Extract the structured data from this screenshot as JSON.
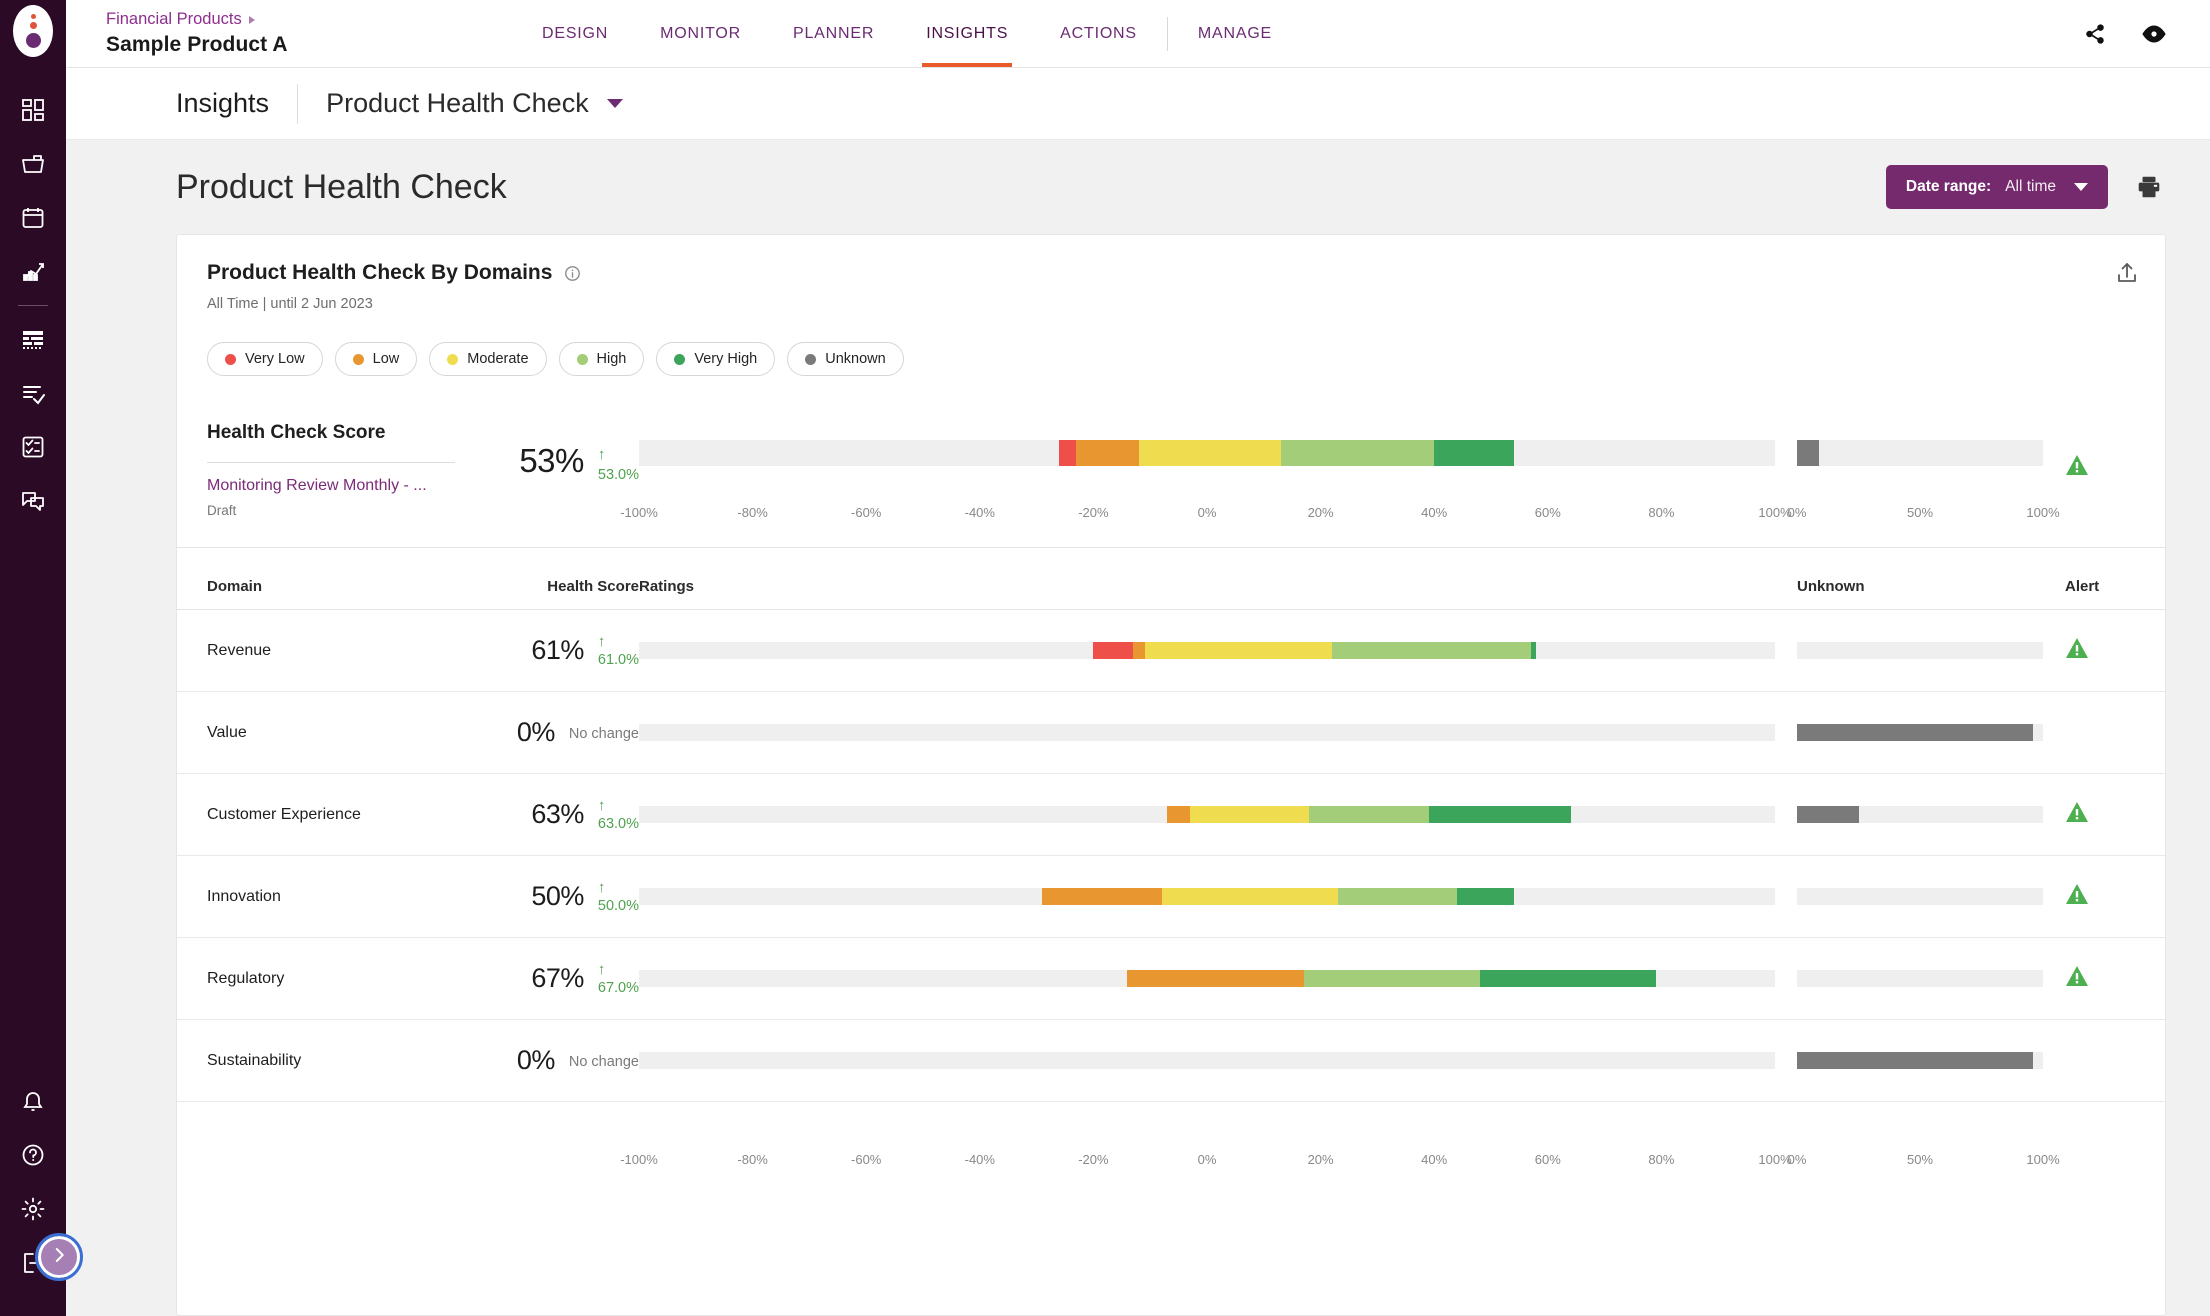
{
  "brand": {
    "accent_purple": "#6B2B72",
    "accent_orange": "#EA5B2A",
    "rail_bg": "#2B0A26"
  },
  "topbar": {
    "breadcrumb_parent": "Financial Products",
    "breadcrumb_title": "Sample Product A",
    "nav": [
      {
        "label": "DESIGN",
        "active": false
      },
      {
        "label": "MONITOR",
        "active": false
      },
      {
        "label": "PLANNER",
        "active": false
      },
      {
        "label": "INSIGHTS",
        "active": true
      },
      {
        "label": "ACTIONS",
        "active": false
      },
      {
        "label": "MANAGE",
        "active": false
      }
    ],
    "icons": [
      "share-icon",
      "eye-icon"
    ]
  },
  "insightsbar": {
    "label": "Insights",
    "selected_report": "Product Health Check"
  },
  "pagehead": {
    "title": "Product Health Check",
    "date_range_label": "Date range:",
    "date_range_value": "All time",
    "print_icon": "print-icon"
  },
  "card": {
    "title": "Product Health Check By Domains",
    "subtitle": "All Time | until 2 Jun 2023",
    "info_icon": "info-icon",
    "export_icon": "export-icon"
  },
  "legend": [
    {
      "label": "Very Low",
      "color": "#EE4F49"
    },
    {
      "label": "Low",
      "color": "#E8962F"
    },
    {
      "label": "Moderate",
      "color": "#EFDC4F"
    },
    {
      "label": "High",
      "color": "#A3CD78"
    },
    {
      "label": "Very High",
      "color": "#3BA55C"
    },
    {
      "label": "Unknown",
      "color": "#7A7A7A"
    }
  ],
  "summary": {
    "heading": "Health Check Score",
    "link": "Monitoring Review Monthly - ...",
    "status": "Draft",
    "score": "53%",
    "delta_arrow": "↑",
    "delta": "53.0%",
    "alert_icon": "alert-triangle-icon"
  },
  "table": {
    "headers": [
      "Domain",
      "Health Score",
      "Ratings",
      "Unknown",
      "Alert"
    ],
    "rows": [
      {
        "domain": "Revenue",
        "score": "61%",
        "delta": "61.0%",
        "delta_arrow": "↑",
        "has_delta_arrow": true,
        "alert": true
      },
      {
        "domain": "Value",
        "score": "0%",
        "delta": "No change",
        "delta_arrow": "",
        "has_delta_arrow": false,
        "alert": false
      },
      {
        "domain": "Customer Experience",
        "score": "63%",
        "delta": "63.0%",
        "delta_arrow": "↑",
        "has_delta_arrow": true,
        "alert": true
      },
      {
        "domain": "Innovation",
        "score": "50%",
        "delta": "50.0%",
        "delta_arrow": "↑",
        "has_delta_arrow": true,
        "alert": true
      },
      {
        "domain": "Regulatory",
        "score": "67%",
        "delta": "67.0%",
        "delta_arrow": "↑",
        "has_delta_arrow": true,
        "alert": true
      },
      {
        "domain": "Sustainability",
        "score": "0%",
        "delta": "No change",
        "delta_arrow": "",
        "has_delta_arrow": false,
        "alert": false
      }
    ]
  },
  "chart_data": {
    "type": "bar",
    "title": "Product Health Check By Domains",
    "subtitle": "All Time | until 2 Jun 2023",
    "orientation": "horizontal-stacked",
    "ratings_axis": {
      "min": -100,
      "max": 100,
      "ticks": [
        -100,
        -80,
        -60,
        -40,
        -20,
        0,
        20,
        40,
        60,
        80,
        100
      ],
      "tick_labels": [
        "-100%",
        "-80%",
        "-60%",
        "-40%",
        "-20%",
        "0%",
        "20%",
        "40%",
        "60%",
        "80%",
        "100%"
      ],
      "unit": "%"
    },
    "unknown_axis": {
      "min": 0,
      "max": 100,
      "ticks": [
        0,
        50,
        100
      ],
      "tick_labels": [
        "0%",
        "50%",
        "100%"
      ],
      "unit": "%"
    },
    "rating_colors": {
      "very_low": "#EE4F49",
      "low": "#E8962F",
      "moderate": "#EFDC4F",
      "high": "#A3CD78",
      "very_high": "#3BA55C",
      "unknown": "#7A7A7A"
    },
    "series": [
      {
        "name": "Health Check Score",
        "score": 53,
        "delta": 53.0,
        "ratings_start": -26,
        "segments": [
          {
            "rating": "very_low",
            "from": -26,
            "to": -23
          },
          {
            "rating": "low",
            "from": -23,
            "to": -12
          },
          {
            "rating": "moderate",
            "from": -12,
            "to": 13
          },
          {
            "rating": "high",
            "from": 13,
            "to": 40
          },
          {
            "rating": "very_high",
            "from": 40,
            "to": 54
          }
        ],
        "unknown": 9
      },
      {
        "name": "Revenue",
        "score": 61,
        "delta": 61.0,
        "segments": [
          {
            "rating": "very_low",
            "from": -20,
            "to": -13
          },
          {
            "rating": "low",
            "from": -13,
            "to": -11
          },
          {
            "rating": "moderate",
            "from": -11,
            "to": 22
          },
          {
            "rating": "high",
            "from": 22,
            "to": 57
          },
          {
            "rating": "very_high",
            "from": 57,
            "to": 58
          }
        ],
        "unknown": 0
      },
      {
        "name": "Value",
        "score": 0,
        "delta": null,
        "segments": [],
        "unknown": 96
      },
      {
        "name": "Customer Experience",
        "score": 63,
        "delta": 63.0,
        "segments": [
          {
            "rating": "low",
            "from": -7,
            "to": -3
          },
          {
            "rating": "moderate",
            "from": -3,
            "to": 18
          },
          {
            "rating": "high",
            "from": 18,
            "to": 39
          },
          {
            "rating": "very_high",
            "from": 39,
            "to": 64
          }
        ],
        "unknown": 25
      },
      {
        "name": "Innovation",
        "score": 50,
        "delta": 50.0,
        "segments": [
          {
            "rating": "low",
            "from": -29,
            "to": -8
          },
          {
            "rating": "moderate",
            "from": -8,
            "to": 23
          },
          {
            "rating": "high",
            "from": 23,
            "to": 44
          },
          {
            "rating": "very_high",
            "from": 44,
            "to": 54
          }
        ],
        "unknown": 0
      },
      {
        "name": "Regulatory",
        "score": 67,
        "delta": 67.0,
        "segments": [
          {
            "rating": "low",
            "from": -14,
            "to": 17
          },
          {
            "rating": "high",
            "from": 17,
            "to": 48
          },
          {
            "rating": "very_high",
            "from": 48,
            "to": 79
          }
        ],
        "unknown": 0
      },
      {
        "name": "Sustainability",
        "score": 0,
        "delta": null,
        "segments": [],
        "unknown": 96
      }
    ]
  },
  "rail": {
    "top_icons": [
      "dashboard-icon",
      "folder-icon",
      "calendar-icon",
      "analytics-icon"
    ],
    "mid_icons": [
      "table-icon",
      "checklist-icon",
      "tasklist-icon",
      "chat-icon"
    ],
    "bottom_icons": [
      "bell-icon",
      "help-icon",
      "settings-icon",
      "logout-icon"
    ],
    "expand_icon": "chevron-right-icon"
  }
}
